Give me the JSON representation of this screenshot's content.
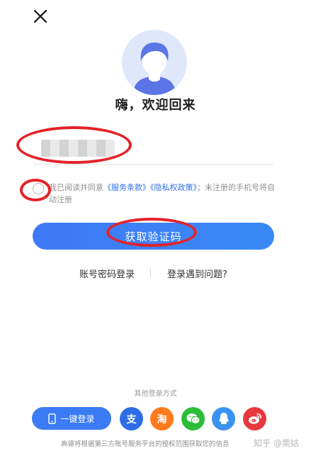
{
  "header": {
    "close_icon": "close-icon"
  },
  "avatar": {
    "icon": "user-avatar-icon",
    "bg": "#dfe8fb",
    "fg": "#5b74e6"
  },
  "welcome": "嗨，欢迎回来",
  "phone": {
    "value": "",
    "placeholder": ""
  },
  "agreement": {
    "prefix": "我已阅读并同意",
    "terms": "《服务条款》",
    "privacy": "《隐私权政策》",
    "suffix": "；未注册的手机号将自动注册",
    "checked": false
  },
  "get_code_button": "获取验证码",
  "links": {
    "password_login": "账号密码登录",
    "problem": "登录遇到问题?"
  },
  "other_login": {
    "title": "其他登录方式",
    "one_click": "一键登录",
    "alipay_glyph": "支",
    "taobao_glyph": "淘"
  },
  "footer": "高德将根据第三方账号服务平台的授权范围获取您的信息",
  "watermark": "知乎 @南姑",
  "colors": {
    "accent": "#3b7bf5",
    "annotation": "#e42229"
  }
}
